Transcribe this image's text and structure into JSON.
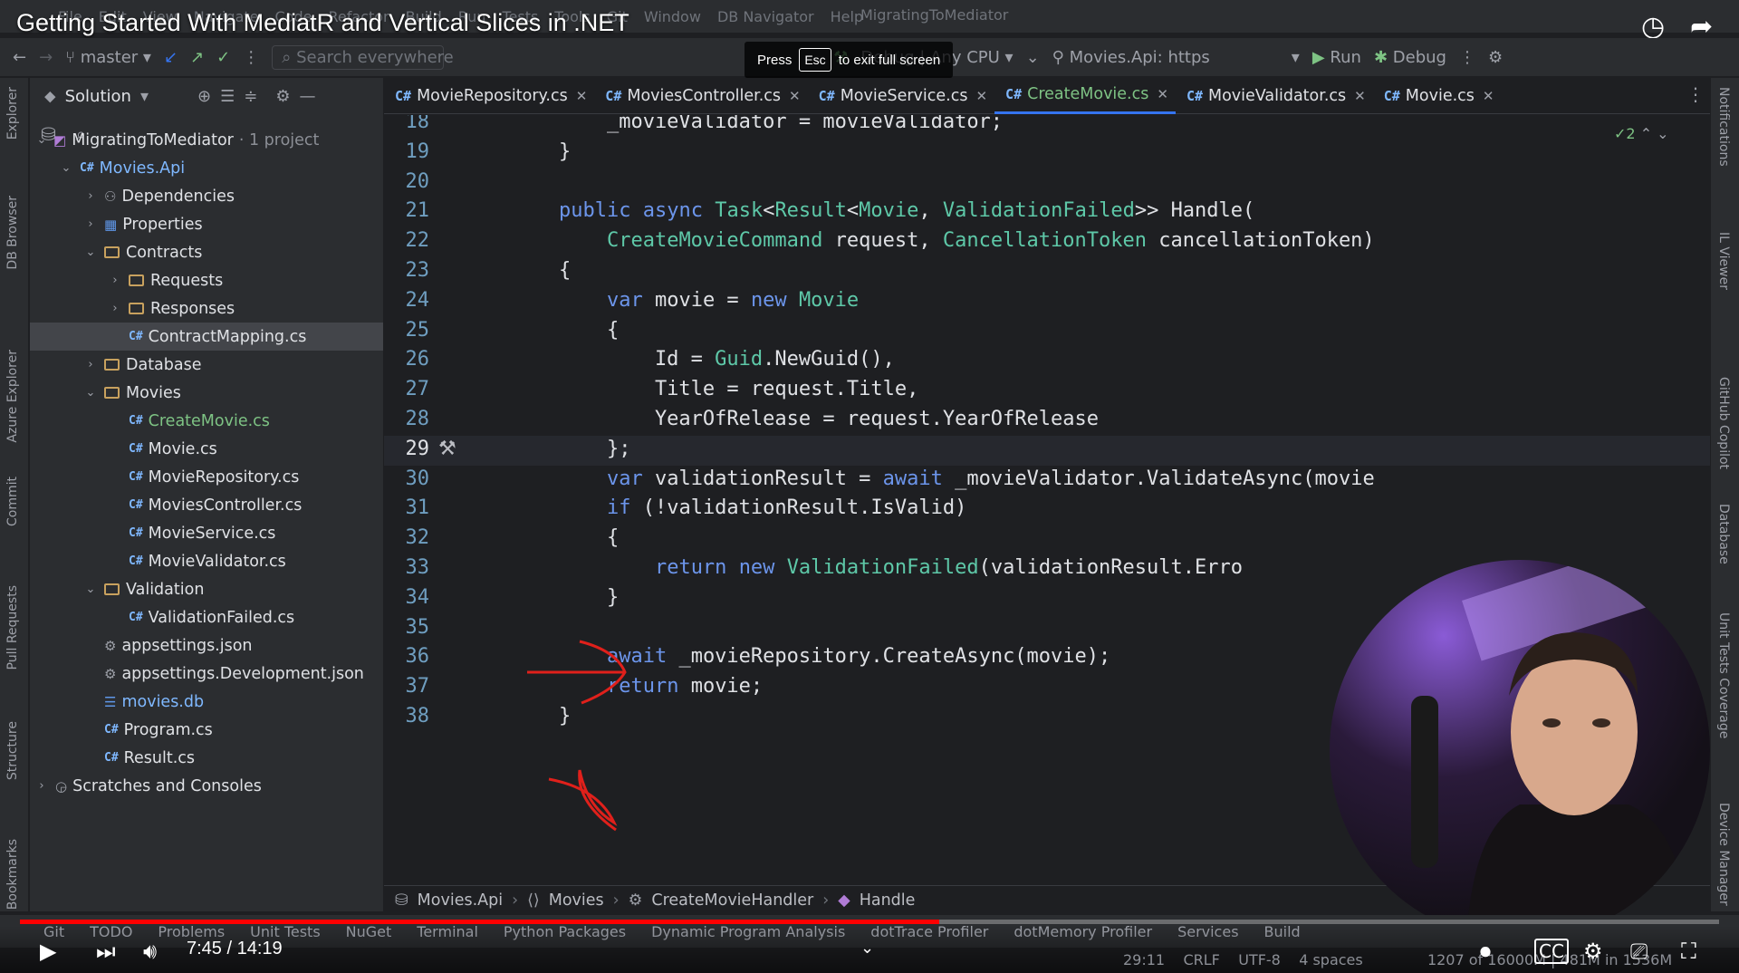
{
  "video": {
    "title": "Getting Started With MediatR and Vertical Slices in .NET",
    "time": "7:45 / 14:19",
    "progress": 0.541,
    "accent": "#ff0000"
  },
  "menu": [
    "File",
    "Edit",
    "View",
    "Navigate",
    "Code",
    "Refactor",
    "Build",
    "Run",
    "Tests",
    "Tools",
    "Git",
    "Window",
    "DB Navigator",
    "Help"
  ],
  "project_name": "MigratingToMediator",
  "toolbar": {
    "branch": "master",
    "search_placeholder": "Search everywhere",
    "config": "Debug | Any CPU",
    "launch_profile": "Movies.Api: https",
    "run": "Run",
    "debug": "Debug"
  },
  "esc_notice": {
    "press": "Press",
    "key": "Esc",
    "text": "to exit full screen"
  },
  "left_tools": [
    "Explorer",
    "DB Browser",
    "Azure Explorer",
    "Commit",
    "Pull Requests",
    "Structure",
    "Bookmarks"
  ],
  "right_tools": [
    "Notifications",
    "IL Viewer",
    "GitHub Copilot",
    "Database",
    "Unit Tests Coverage",
    "Device Manager"
  ],
  "explorer": {
    "header": "Solution",
    "solution": "MigratingToMediator",
    "solution_suffix": "· 1 project",
    "tree": [
      {
        "label": "Movies.Api",
        "kind": "cs-project",
        "depth": 1,
        "open": true
      },
      {
        "label": "Dependencies",
        "kind": "deps",
        "depth": 2,
        "open": false
      },
      {
        "label": "Properties",
        "kind": "props",
        "depth": 2,
        "open": false
      },
      {
        "label": "Contracts",
        "kind": "folder",
        "depth": 2,
        "open": true
      },
      {
        "label": "Requests",
        "kind": "folder",
        "depth": 3,
        "open": false
      },
      {
        "label": "Responses",
        "kind": "folder",
        "depth": 3,
        "open": false
      },
      {
        "label": "ContractMapping.cs",
        "kind": "cs",
        "depth": 3,
        "selected": true
      },
      {
        "label": "Database",
        "kind": "folder",
        "depth": 2,
        "open": false
      },
      {
        "label": "Movies",
        "kind": "folder",
        "depth": 2,
        "open": true
      },
      {
        "label": "CreateMovie.cs",
        "kind": "cs",
        "depth": 3,
        "green": true
      },
      {
        "label": "Movie.cs",
        "kind": "cs",
        "depth": 3
      },
      {
        "label": "MovieRepository.cs",
        "kind": "cs",
        "depth": 3
      },
      {
        "label": "MoviesController.cs",
        "kind": "cs",
        "depth": 3
      },
      {
        "label": "MovieService.cs",
        "kind": "cs",
        "depth": 3
      },
      {
        "label": "MovieValidator.cs",
        "kind": "cs",
        "depth": 3
      },
      {
        "label": "Validation",
        "kind": "folder",
        "depth": 2,
        "open": true
      },
      {
        "label": "ValidationFailed.cs",
        "kind": "cs",
        "depth": 3
      },
      {
        "label": "appsettings.json",
        "kind": "json",
        "depth": 2
      },
      {
        "label": "appsettings.Development.json",
        "kind": "json",
        "depth": 2
      },
      {
        "label": "movies.db",
        "kind": "db",
        "depth": 2,
        "blue": true
      },
      {
        "label": "Program.cs",
        "kind": "cs",
        "depth": 2
      },
      {
        "label": "Result.cs",
        "kind": "cs",
        "depth": 2
      },
      {
        "label": "Scratches and Consoles",
        "kind": "scratch",
        "depth": 0,
        "open": false
      }
    ]
  },
  "tabs": [
    {
      "label": "MovieRepository.cs",
      "active": false
    },
    {
      "label": "MoviesController.cs",
      "active": false
    },
    {
      "label": "MovieService.cs",
      "active": false
    },
    {
      "label": "CreateMovie.cs",
      "active": true
    },
    {
      "label": "MovieValidator.cs",
      "active": false
    },
    {
      "label": "Movie.cs",
      "active": false
    }
  ],
  "inspections": "✓2",
  "code": [
    {
      "n": "18",
      "t": "        _movieValidator = movieValidator;"
    },
    {
      "n": "19",
      "t": "    }"
    },
    {
      "n": "20",
      "t": ""
    },
    {
      "n": "21",
      "t": "    public async Task<Result<Movie, ValidationFailed>> Handle("
    },
    {
      "n": "22",
      "t": "        CreateMovieCommand request, CancellationToken cancellationToken)"
    },
    {
      "n": "23",
      "t": "    {"
    },
    {
      "n": "24",
      "t": "        var movie = new Movie"
    },
    {
      "n": "25",
      "t": "        {"
    },
    {
      "n": "26",
      "t": "            Id = Guid.NewGuid(),"
    },
    {
      "n": "27",
      "t": "            Title = request.Title,"
    },
    {
      "n": "28",
      "t": "            YearOfRelease = request.YearOfRelease"
    },
    {
      "n": "29",
      "t": "        };"
    },
    {
      "n": "30",
      "t": "        var validationResult = await _movieValidator.ValidateAsync(movie"
    },
    {
      "n": "31",
      "t": "        if (!validationResult.IsValid)"
    },
    {
      "n": "32",
      "t": "        {"
    },
    {
      "n": "33",
      "t": "            return new ValidationFailed(validationResult.Erro"
    },
    {
      "n": "34",
      "t": "        }"
    },
    {
      "n": "35",
      "t": ""
    },
    {
      "n": "36",
      "t": "        await _movieRepository.CreateAsync(movie);"
    },
    {
      "n": "37",
      "t": "        return movie;"
    },
    {
      "n": "38",
      "t": "    }"
    }
  ],
  "current_line": "29",
  "breadcrumb": [
    "Movies.Api",
    "Movies",
    "CreateMovieHandler",
    "Handle"
  ],
  "tool_windows": [
    "Git",
    "TODO",
    "Problems",
    "Unit Tests",
    "NuGet",
    "Terminal",
    "Python Packages",
    "Dynamic Program Analysis",
    "dotTrace Profiler",
    "dotMemory Profiler",
    "Services",
    "Build"
  ],
  "status": {
    "position": "29:11",
    "line_sep": "CRLF",
    "encoding": "UTF-8",
    "indent": "4 spaces",
    "memory": "1207 of 16000M",
    "extra": "481M in 1536M"
  }
}
